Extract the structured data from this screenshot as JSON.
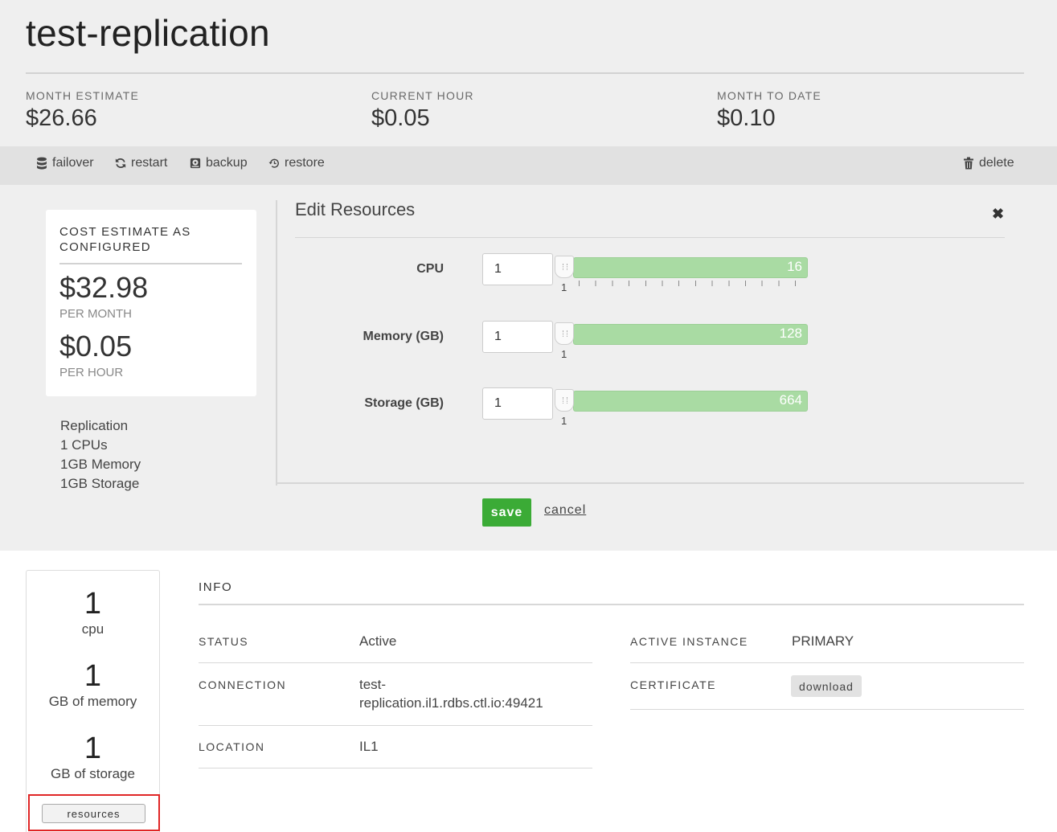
{
  "header": {
    "title": "test-replication",
    "stats": [
      {
        "label": "MONTH ESTIMATE",
        "value": "$26.66"
      },
      {
        "label": "CURRENT HOUR",
        "value": "$0.05"
      },
      {
        "label": "MONTH TO DATE",
        "value": "$0.10"
      }
    ]
  },
  "toolbar": {
    "failover": {
      "label": "failover",
      "icon": "database-icon"
    },
    "restart": {
      "label": "restart",
      "icon": "refresh-icon"
    },
    "backup": {
      "label": "backup",
      "icon": "hdd-icon"
    },
    "restore": {
      "label": "restore",
      "icon": "history-icon"
    },
    "delete": {
      "label": "delete",
      "icon": "trash-icon"
    }
  },
  "cost_card": {
    "title_line1": "COST ESTIMATE AS",
    "title_line2": "CONFIGURED",
    "monthly": "$32.98",
    "monthly_label": "PER MONTH",
    "hourly": "$0.05",
    "hourly_label": "PER HOUR"
  },
  "summary": {
    "type": "Replication",
    "cpus": "1 CPUs",
    "memory": "1GB Memory",
    "storage": "1GB Storage"
  },
  "edit_resources": {
    "title": "Edit Resources",
    "close": "✖",
    "cpu": {
      "label": "CPU",
      "value": "1",
      "min": "1",
      "max": "16"
    },
    "memory": {
      "label": "Memory (GB)",
      "value": "1",
      "min": "1",
      "max": "128"
    },
    "storage": {
      "label": "Storage (GB)",
      "value": "1",
      "min": "1",
      "max": "664"
    },
    "save_label": "save",
    "cancel_label": "cancel"
  },
  "resources_panel": {
    "cpu_value": "1",
    "cpu_label": "cpu",
    "memory_value": "1",
    "memory_label": "GB of memory",
    "storage_value": "1",
    "storage_label": "GB of storage",
    "button_label": "resources"
  },
  "info": {
    "title": "INFO",
    "status_key": "STATUS",
    "status_value": "Active",
    "connection_key": "CONNECTION",
    "connection_line1": "test-",
    "connection_line2": "replication.il1.rdbs.ctl.io:49421",
    "location_key": "LOCATION",
    "location_value": "IL1",
    "active_instance_key": "ACTIVE INSTANCE",
    "active_instance_value": "PRIMARY",
    "certificate_key": "CERTIFICATE",
    "certificate_button": "download"
  },
  "colors": {
    "slider_fill": "#a9dba3",
    "save_button": "#3bab36",
    "highlight_border": "#e02626"
  }
}
